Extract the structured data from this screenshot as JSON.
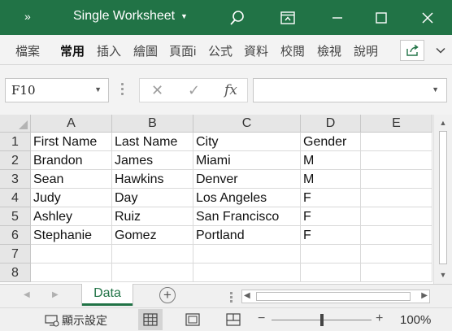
{
  "window": {
    "title": "Single Worksheet",
    "chevron": "»",
    "title_caret": "▼",
    "buttons": [
      "search-icon",
      "ribbon-display-icon",
      "minimize-icon",
      "maximize-icon",
      "close-icon"
    ]
  },
  "ribbon": {
    "tabs": [
      "檔案",
      "常用",
      "插入",
      "繪圖",
      "頁面i",
      "公式",
      "資料",
      "校閱",
      "檢視",
      "說明"
    ],
    "active_tab": "常用"
  },
  "formula_bar": {
    "name_box": "F10",
    "cancel_icon": "✕",
    "enter_icon": "✓",
    "function_icon": "fx",
    "formula": ""
  },
  "sheet": {
    "columns": [
      "A",
      "B",
      "C",
      "D",
      "E"
    ],
    "rows": [
      "1",
      "2",
      "3",
      "4",
      "5",
      "6",
      "7",
      "8"
    ],
    "cells": [
      [
        "First Name",
        "Last Name",
        "City",
        "Gender",
        ""
      ],
      [
        "Brandon",
        "James",
        "Miami",
        "M",
        ""
      ],
      [
        "Sean",
        "Hawkins",
        "Denver",
        "M",
        ""
      ],
      [
        "Judy",
        "Day",
        "Los Angeles",
        "F",
        ""
      ],
      [
        "Ashley",
        "Ruiz",
        "San Francisco",
        "F",
        ""
      ],
      [
        "Stephanie",
        "Gomez",
        "Portland",
        "F",
        ""
      ],
      [
        "",
        "",
        "",
        "",
        ""
      ],
      [
        "",
        "",
        "",
        "",
        ""
      ]
    ]
  },
  "tabs_bar": {
    "sheet_tab": "Data",
    "add_sheet": "+"
  },
  "status_bar": {
    "display_settings": "顯示設定",
    "zoom_minus": "−",
    "zoom_plus": "+",
    "zoom_level": "100%",
    "zoom_fraction": 0.5
  },
  "colors": {
    "accent": "#217346",
    "ribbon_bg": "#f3f3f3",
    "header_bg": "#e6e6e6"
  }
}
